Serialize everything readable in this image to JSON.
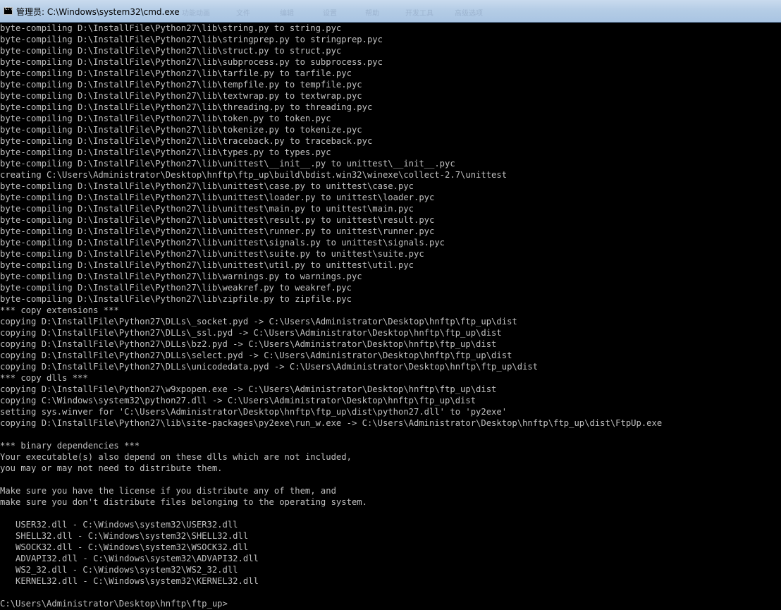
{
  "window": {
    "title": "管理员: C:\\Windows\\system32\\cmd.exe",
    "ghost_menu": [
      "功能动画",
      "文件",
      "编辑",
      "设置",
      "帮助",
      "开发工具",
      "高级选项"
    ]
  },
  "console": {
    "lines": [
      "byte-compiling D:\\InstallFile\\Python27\\lib\\string.py to string.pyc",
      "byte-compiling D:\\InstallFile\\Python27\\lib\\stringprep.py to stringprep.pyc",
      "byte-compiling D:\\InstallFile\\Python27\\lib\\struct.py to struct.pyc",
      "byte-compiling D:\\InstallFile\\Python27\\lib\\subprocess.py to subprocess.pyc",
      "byte-compiling D:\\InstallFile\\Python27\\lib\\tarfile.py to tarfile.pyc",
      "byte-compiling D:\\InstallFile\\Python27\\lib\\tempfile.py to tempfile.pyc",
      "byte-compiling D:\\InstallFile\\Python27\\lib\\textwrap.py to textwrap.pyc",
      "byte-compiling D:\\InstallFile\\Python27\\lib\\threading.py to threading.pyc",
      "byte-compiling D:\\InstallFile\\Python27\\lib\\token.py to token.pyc",
      "byte-compiling D:\\InstallFile\\Python27\\lib\\tokenize.py to tokenize.pyc",
      "byte-compiling D:\\InstallFile\\Python27\\lib\\traceback.py to traceback.pyc",
      "byte-compiling D:\\InstallFile\\Python27\\lib\\types.py to types.pyc",
      "byte-compiling D:\\InstallFile\\Python27\\lib\\unittest\\__init__.py to unittest\\__init__.pyc",
      "creating C:\\Users\\Administrator\\Desktop\\hnftp\\ftp_up\\build\\bdist.win32\\winexe\\collect-2.7\\unittest",
      "byte-compiling D:\\InstallFile\\Python27\\lib\\unittest\\case.py to unittest\\case.pyc",
      "byte-compiling D:\\InstallFile\\Python27\\lib\\unittest\\loader.py to unittest\\loader.pyc",
      "byte-compiling D:\\InstallFile\\Python27\\lib\\unittest\\main.py to unittest\\main.pyc",
      "byte-compiling D:\\InstallFile\\Python27\\lib\\unittest\\result.py to unittest\\result.pyc",
      "byte-compiling D:\\InstallFile\\Python27\\lib\\unittest\\runner.py to unittest\\runner.pyc",
      "byte-compiling D:\\InstallFile\\Python27\\lib\\unittest\\signals.py to unittest\\signals.pyc",
      "byte-compiling D:\\InstallFile\\Python27\\lib\\unittest\\suite.py to unittest\\suite.pyc",
      "byte-compiling D:\\InstallFile\\Python27\\lib\\unittest\\util.py to unittest\\util.pyc",
      "byte-compiling D:\\InstallFile\\Python27\\lib\\warnings.py to warnings.pyc",
      "byte-compiling D:\\InstallFile\\Python27\\lib\\weakref.py to weakref.pyc",
      "byte-compiling D:\\InstallFile\\Python27\\lib\\zipfile.py to zipfile.pyc",
      "*** copy extensions ***",
      "copying D:\\InstallFile\\Python27\\DLLs\\_socket.pyd -> C:\\Users\\Administrator\\Desktop\\hnftp\\ftp_up\\dist",
      "copying D:\\InstallFile\\Python27\\DLLs\\_ssl.pyd -> C:\\Users\\Administrator\\Desktop\\hnftp\\ftp_up\\dist",
      "copying D:\\InstallFile\\Python27\\DLLs\\bz2.pyd -> C:\\Users\\Administrator\\Desktop\\hnftp\\ftp_up\\dist",
      "copying D:\\InstallFile\\Python27\\DLLs\\select.pyd -> C:\\Users\\Administrator\\Desktop\\hnftp\\ftp_up\\dist",
      "copying D:\\InstallFile\\Python27\\DLLs\\unicodedata.pyd -> C:\\Users\\Administrator\\Desktop\\hnftp\\ftp_up\\dist",
      "*** copy dlls ***",
      "copying D:\\InstallFile\\Python27\\w9xpopen.exe -> C:\\Users\\Administrator\\Desktop\\hnftp\\ftp_up\\dist",
      "copying C:\\Windows\\system32\\python27.dll -> C:\\Users\\Administrator\\Desktop\\hnftp\\ftp_up\\dist",
      "setting sys.winver for 'C:\\Users\\Administrator\\Desktop\\hnftp\\ftp_up\\dist\\python27.dll' to 'py2exe'",
      "copying D:\\InstallFile\\Python27\\lib\\site-packages\\py2exe\\run_w.exe -> C:\\Users\\Administrator\\Desktop\\hnftp\\ftp_up\\dist\\FtpUp.exe",
      "",
      "*** binary dependencies ***",
      "Your executable(s) also depend on these dlls which are not included,",
      "you may or may not need to distribute them.",
      "",
      "Make sure you have the license if you distribute any of them, and",
      "make sure you don't distribute files belonging to the operating system.",
      "",
      "   USER32.dll - C:\\Windows\\system32\\USER32.dll",
      "   SHELL32.dll - C:\\Windows\\system32\\SHELL32.dll",
      "   WSOCK32.dll - C:\\Windows\\system32\\WSOCK32.dll",
      "   ADVAPI32.dll - C:\\Windows\\system32\\ADVAPI32.dll",
      "   WS2_32.dll - C:\\Windows\\system32\\WS2_32.dll",
      "   KERNEL32.dll - C:\\Windows\\system32\\KERNEL32.dll",
      "",
      "C:\\Users\\Administrator\\Desktop\\hnftp\\ftp_up>"
    ]
  },
  "colors": {
    "console_bg": "#000000",
    "console_fg": "#c0c0c0",
    "titlebar": "#b5cde6"
  }
}
